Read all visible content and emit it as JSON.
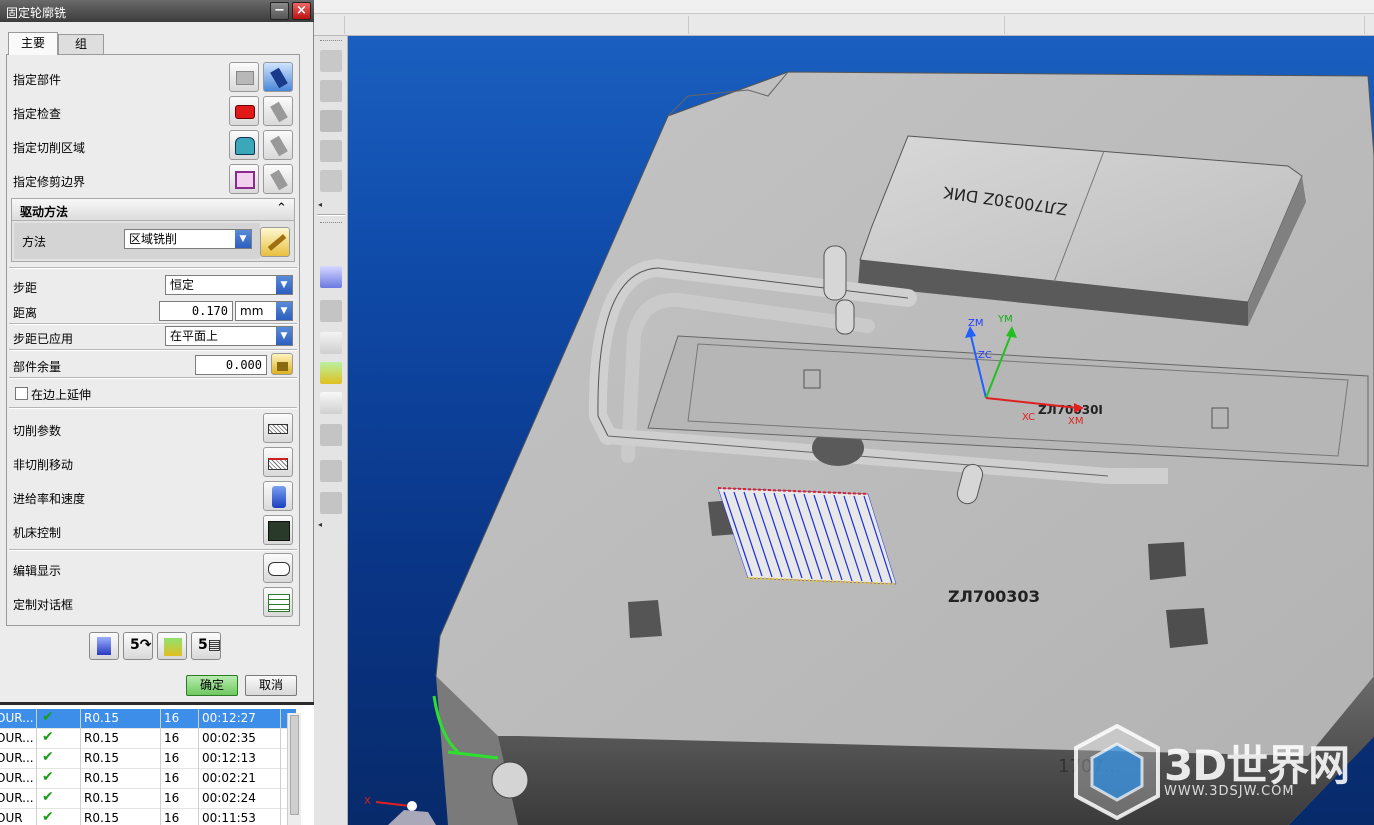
{
  "dialog": {
    "title": "固定轮廓铣",
    "tabs": [
      "主要",
      "组"
    ],
    "geometry_rows": [
      {
        "label": "指定部件"
      },
      {
        "label": "指定检查"
      },
      {
        "label": "指定切削区域"
      },
      {
        "label": "指定修剪边界"
      }
    ],
    "drive": {
      "section_label": "驱动方法",
      "method_label": "方法",
      "method_value": "区域铣削"
    },
    "stepover_label": "步距",
    "stepover_value": "恒定",
    "distance_label": "距离",
    "distance_value": "0.170",
    "distance_unit": "mm",
    "applied_label": "步距已应用",
    "applied_value": "在平面上",
    "stock_label": "部件余量",
    "stock_value": "0.000",
    "extend_label": "在边上延伸",
    "settings": [
      {
        "label": "切削参数"
      },
      {
        "label": "非切削移动"
      },
      {
        "label": "进给率和速度"
      },
      {
        "label": "机床控制"
      }
    ],
    "options": [
      {
        "label": "编辑显示"
      },
      {
        "label": "定制对话框"
      }
    ],
    "ok_label": "确定",
    "cancel_label": "取消"
  },
  "operations": [
    {
      "name": "OUR...",
      "tool": "R0.15",
      "num": "16",
      "time": "00:12:27",
      "selected": true
    },
    {
      "name": "OUR...",
      "tool": "R0.15",
      "num": "16",
      "time": "00:02:35"
    },
    {
      "name": "OUR...",
      "tool": "R0.15",
      "num": "16",
      "time": "00:12:13"
    },
    {
      "name": "OUR...",
      "tool": "R0.15",
      "num": "16",
      "time": "00:02:21"
    },
    {
      "name": "OUR...",
      "tool": "R0.15",
      "num": "16",
      "time": "00:02:24"
    },
    {
      "name": "OUR",
      "tool": "R0.15",
      "num": "16",
      "time": "00:11:53"
    }
  ],
  "model": {
    "engraving_1": "ZЛ70030Z DИK",
    "engraving_2": "ZЛ70030I",
    "engraving_3": "ZЛ70030З",
    "engraving_4": "1707..."
  },
  "axes": {
    "zm": "ZM",
    "ym": "YM",
    "zc": "ZC",
    "xc": "XC",
    "xm": "XM",
    "corner_x": "X"
  },
  "watermark": {
    "brand": "3D世界网",
    "url": "WWW.3DSJW.COM"
  },
  "colors": {
    "viewport_top": "#1a5fc0",
    "viewport_bottom": "#072a6a",
    "ok_green": "#6fc860",
    "selected_row": "#3d8ee8",
    "toolpath": "#1a2fe0"
  }
}
